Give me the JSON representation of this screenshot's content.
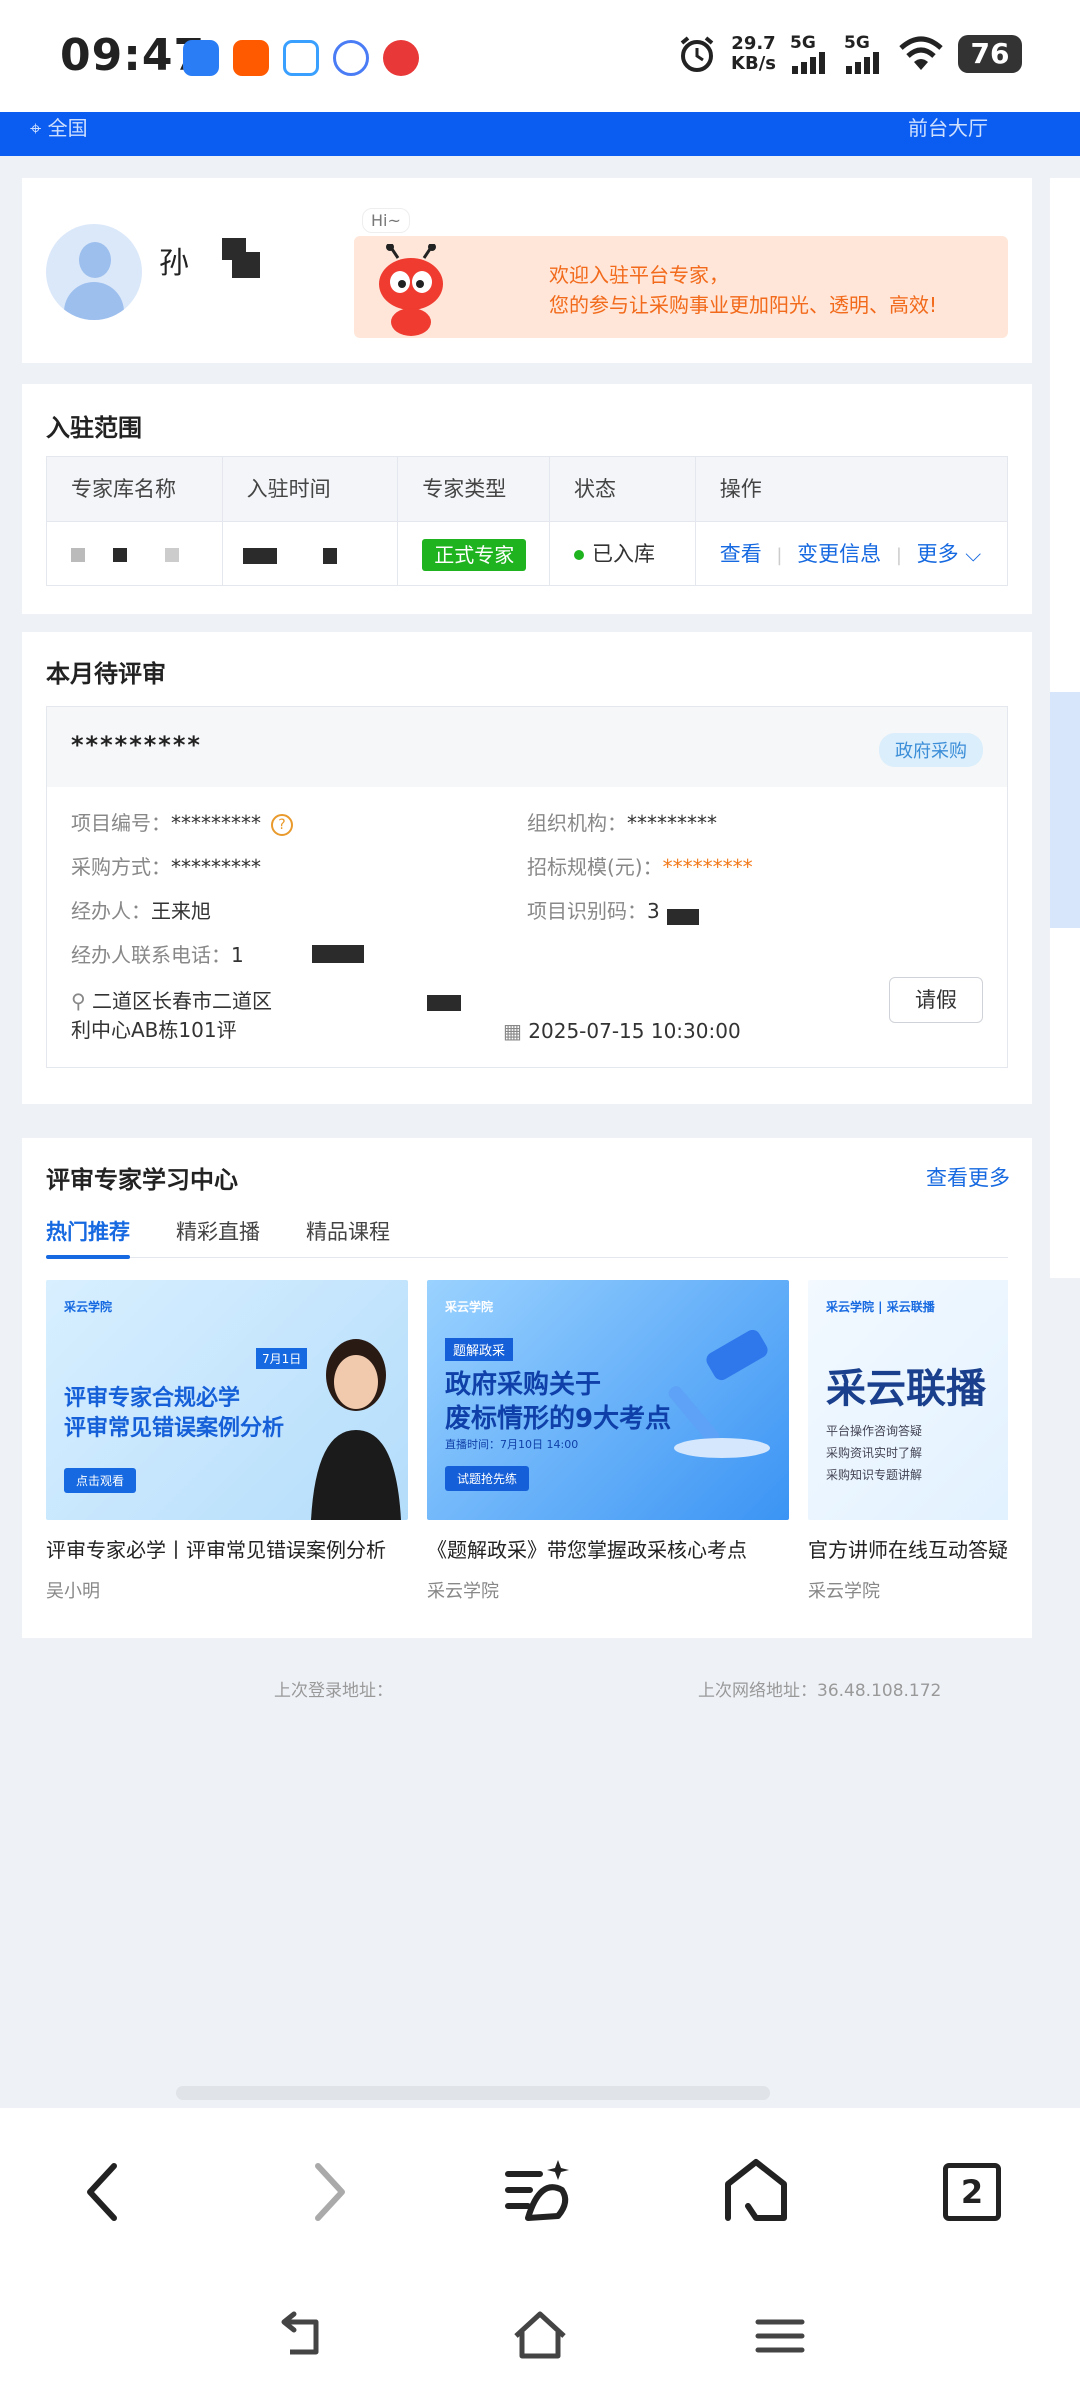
{
  "status_bar": {
    "time": "09:47",
    "net_speed_value": "29.7",
    "net_speed_unit": "KB/s",
    "signal1": "5G",
    "signal2": "5G",
    "battery": "76",
    "app_icons": [
      "baidu-netdisk-icon",
      "taobao-icon",
      "chat-bubble-icon",
      "app-rings-icon",
      "red-panda-icon"
    ],
    "app_colors": [
      "#2a7df4",
      "#ff5a00",
      "#3aa0ff",
      "#4a7cf5",
      "#e83838"
    ]
  },
  "header": {
    "location": "全国",
    "portal": "前台大厅"
  },
  "profile": {
    "name": "孙",
    "hi": "Hi~",
    "welcome_line1": "欢迎入驻平台专家，",
    "welcome_line2": "您的参与让采购事业更加阳光、透明、高效!"
  },
  "scope": {
    "title": "入驻范围",
    "columns": [
      "专家库名称",
      "入驻时间",
      "专家类型",
      "状态",
      "操作"
    ],
    "row": {
      "type": "正式专家",
      "status": "已入库",
      "actions": [
        "查看",
        "变更信息",
        "更多"
      ]
    }
  },
  "pending": {
    "title": "本月待评审",
    "project_name": "*********",
    "badge": "政府采购",
    "project_no_label": "项目编号：",
    "project_no": "*********",
    "org_label": "组织机构：",
    "org": "*********",
    "method_label": "采购方式：",
    "method": "*********",
    "scale_label": "招标规模(元)：",
    "scale": "*********",
    "handler_label": "经办人：",
    "handler": "王来旭",
    "code_label": "项目识别码：",
    "code": "3",
    "phone_label": "经办人联系电话：",
    "phone": "1",
    "address_line1": "二道区长春市二道区",
    "address_line2": "利中心AB栋101评",
    "datetime": "2025-07-15 10:30:00",
    "leave_button": "请假"
  },
  "learning": {
    "title": "评审专家学习中心",
    "more": "查看更多",
    "tabs": [
      "热门推荐",
      "精彩直播",
      "精品课程"
    ],
    "active_tab": 0,
    "courses": [
      {
        "title": "评审专家必学丨评审常见错误案例分析",
        "author": "吴小明",
        "thumb_logo": "采云学院",
        "thumb_line1": "评审专家合规必学",
        "thumb_line2": "评审常见错误案例分析",
        "thumb_date": "7月1日",
        "thumb_button": "点击观看"
      },
      {
        "title": "《题解政采》带您掌握政采核心考点",
        "author": "采云学院",
        "thumb_logo": "采云学院",
        "thumb_tag": "题解政采",
        "thumb_line1": "政府采购关于",
        "thumb_line2": "废标情形的9大考点",
        "thumb_date": "直播时间：7月10日 14:00",
        "thumb_button": "试题抢先练"
      },
      {
        "title": "官方讲师在线互动答疑",
        "author": "采云学院",
        "thumb_logo": "采云学院 | 采云联播",
        "thumb_big": "采云联播",
        "thumb_items": [
          "平台操作咨询答疑",
          "采购资讯实时了解",
          "采购知识专题讲解"
        ]
      }
    ]
  },
  "footer": {
    "last_login_addr_label": "上次登录地址：",
    "last_net_addr_label": "上次网络地址：",
    "last_net_addr": "36.48.108.172"
  },
  "nav": {
    "tab_count": "2"
  },
  "colors": {
    "primary_blue": "#0b5cf0",
    "link_blue": "#1669e0",
    "success_green": "#1fb31f",
    "warn_orange": "#f26a1b"
  }
}
